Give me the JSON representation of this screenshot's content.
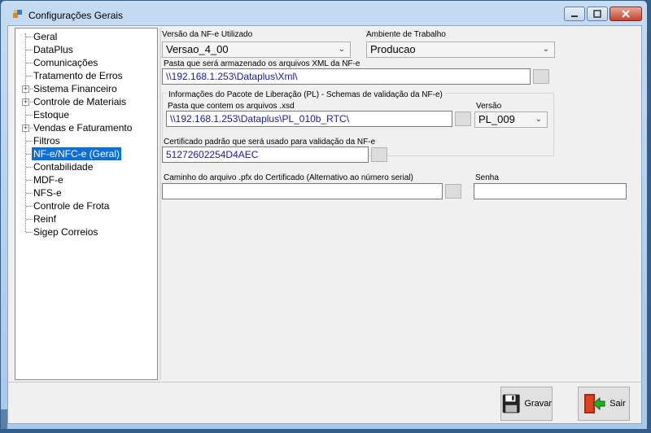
{
  "window": {
    "title": "Configurações Gerais"
  },
  "tree": {
    "items": [
      {
        "label": "Geral",
        "expandable": false
      },
      {
        "label": "DataPlus",
        "expandable": false
      },
      {
        "label": "Comunicações",
        "expandable": false
      },
      {
        "label": "Tratamento de Erros",
        "expandable": false
      },
      {
        "label": "Sistema Financeiro",
        "expandable": true
      },
      {
        "label": "Controle de Materiais",
        "expandable": true
      },
      {
        "label": "Estoque",
        "expandable": false
      },
      {
        "label": "Vendas e Faturamento",
        "expandable": true
      },
      {
        "label": "Filtros",
        "expandable": false
      },
      {
        "label": "NF-e/NFC-e (Geral)",
        "expandable": false,
        "selected": true
      },
      {
        "label": "Contabilidade",
        "expandable": false
      },
      {
        "label": "MDF-e",
        "expandable": false
      },
      {
        "label": "NFS-e",
        "expandable": false
      },
      {
        "label": "Controle de Frota",
        "expandable": false
      },
      {
        "label": "Reinf",
        "expandable": false
      },
      {
        "label": "Sigep Correios",
        "expandable": false
      }
    ]
  },
  "form": {
    "versao_nfe_label": "Versão da NF-e Utilizado",
    "versao_nfe_value": "Versao_4_00",
    "ambiente_label": "Ambiente de Trabalho",
    "ambiente_value": "Producao",
    "pasta_xml_label": "Pasta que será armazenado os arquivos XML da NF-e",
    "pasta_xml_value": "\\\\192.168.1.253\\Dataplus\\Xml\\",
    "pl_group_label": "Informações do Pacote de Liberação (PL) - Schemas de validação da NF-e)",
    "pasta_xsd_label": "Pasta que contem os arquivos .xsd",
    "pasta_xsd_value": "\\\\192.168.1.253\\Dataplus\\PL_010b_RTC\\",
    "versao_pl_label": "Versão",
    "versao_pl_value": "PL_009",
    "certificado_label": "Certificado padrão que será usado para validação da NF-e",
    "certificado_value": "51272602254D4AEC",
    "caminho_pfx_label": "Caminho do arquivo .pfx do Certificado (Alternativo ao número serial)",
    "caminho_pfx_value": "",
    "senha_label": "Senha",
    "senha_value": ""
  },
  "buttons": {
    "gravar": "Gravar",
    "sair": "Sair"
  },
  "colors": {
    "selection": "#0a6fd8",
    "path_text": "#1a1a9c"
  }
}
